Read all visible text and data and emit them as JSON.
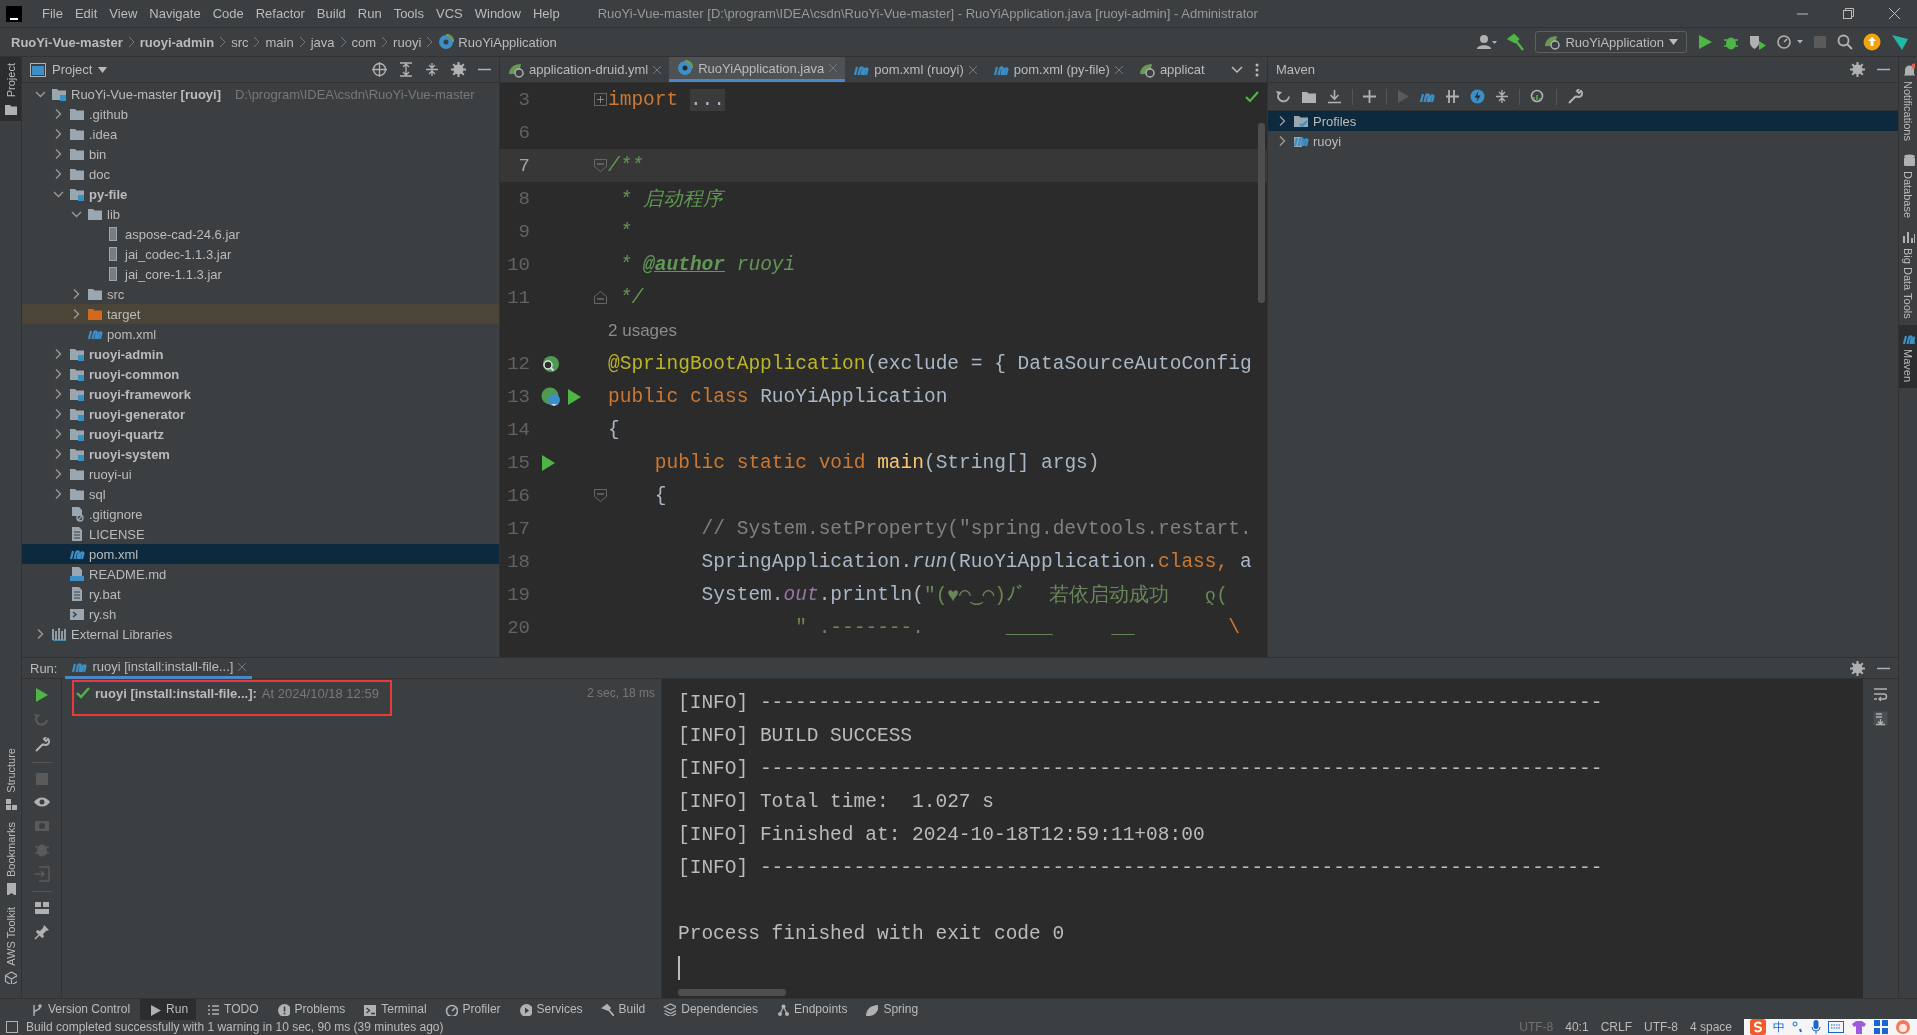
{
  "title_bar": {
    "menu": [
      "File",
      "Edit",
      "View",
      "Navigate",
      "Code",
      "Refactor",
      "Build",
      "Run",
      "Tools",
      "VCS",
      "Window",
      "Help"
    ],
    "title": "RuoYi-Vue-master [D:\\program\\IDEA\\csdn\\RuoYi-Vue-master] - RuoYiApplication.java [ruoyi-admin] - Administrator"
  },
  "nav_bar": {
    "breadcrumbs": [
      {
        "label": "RuoYi-Vue-master",
        "bold": true
      },
      {
        "label": "ruoyi-admin",
        "bold": true
      },
      {
        "label": "src",
        "bold": false
      },
      {
        "label": "main",
        "bold": false
      },
      {
        "label": "java",
        "bold": false
      },
      {
        "label": "com",
        "bold": false
      },
      {
        "label": "ruoyi",
        "bold": false
      },
      {
        "label": "RuoYiApplication",
        "bold": false,
        "kind": "class"
      }
    ],
    "run_config": "RuoYiApplication"
  },
  "left_stripe": [
    {
      "label": "Project",
      "selected": true,
      "kind": "folder"
    },
    {
      "label": "Structure",
      "selected": false,
      "kind": "structure"
    },
    {
      "label": "Bookmarks",
      "selected": false,
      "kind": "bookmark"
    },
    {
      "label": "AWS Toolkit",
      "selected": false,
      "kind": "cube"
    }
  ],
  "right_stripe": [
    {
      "label": "Notifications",
      "selected": false,
      "kind": "bell"
    },
    {
      "label": "Database",
      "selected": false,
      "kind": "database"
    },
    {
      "label": "Big Data Tools",
      "selected": false,
      "kind": "bigdata"
    },
    {
      "label": "Maven",
      "selected": true,
      "kind": "maven"
    }
  ],
  "project_panel": {
    "title": "Project",
    "tree": [
      {
        "label": "RuoYi-Vue-master **[ruoyi]**",
        "path": "D:\\program\\IDEA\\csdn\\RuoYi-Vue-master",
        "kind": "root",
        "expanded": true,
        "selected": false,
        "children": [
          {
            "label": ".github",
            "kind": "folder",
            "expanded": false,
            "selected": false
          },
          {
            "label": ".idea",
            "kind": "folder",
            "expanded": false,
            "selected": false
          },
          {
            "label": "bin",
            "kind": "folder",
            "expanded": false,
            "selected": false
          },
          {
            "label": "doc",
            "kind": "folder",
            "expanded": false,
            "selected": false
          },
          {
            "label": "py-file",
            "kind": "module",
            "expanded": true,
            "selected": false,
            "children": [
              {
                "label": "lib",
                "kind": "folder",
                "expanded": true,
                "selected": false,
                "children": [
                  {
                    "label": "aspose-cad-24.6.jar",
                    "kind": "jar",
                    "selected": false
                  },
                  {
                    "label": "jai_codec-1.1.3.jar",
                    "kind": "jar",
                    "selected": false
                  },
                  {
                    "label": "jai_core-1.1.3.jar",
                    "kind": "jar",
                    "selected": false
                  }
                ]
              },
              {
                "label": "src",
                "kind": "folder",
                "expanded": false,
                "selected": false
              },
              {
                "label": "target",
                "kind": "excluded",
                "expanded": false,
                "selected": false
              },
              {
                "label": "pom.xml",
                "kind": "maven",
                "selected": false
              }
            ]
          },
          {
            "label": "ruoyi-admin",
            "kind": "module",
            "expanded": false,
            "selected": false
          },
          {
            "label": "ruoyi-common",
            "kind": "module",
            "expanded": false,
            "selected": false
          },
          {
            "label": "ruoyi-framework",
            "kind": "module",
            "expanded": false,
            "selected": false
          },
          {
            "label": "ruoyi-generator",
            "kind": "module",
            "expanded": false,
            "selected": false
          },
          {
            "label": "ruoyi-quartz",
            "kind": "module",
            "expanded": false,
            "selected": false
          },
          {
            "label": "ruoyi-system",
            "kind": "module",
            "expanded": false,
            "selected": false
          },
          {
            "label": "ruoyi-ui",
            "kind": "folder",
            "expanded": false,
            "selected": false
          },
          {
            "label": "sql",
            "kind": "folder",
            "expanded": false,
            "selected": false
          },
          {
            "label": ".gitignore",
            "kind": "gitignore",
            "selected": false
          },
          {
            "label": "LICENSE",
            "kind": "text",
            "selected": false
          },
          {
            "label": "pom.xml",
            "kind": "maven",
            "selected": true
          },
          {
            "label": "README.md",
            "kind": "markdown",
            "selected": false
          },
          {
            "label": "ry.bat",
            "kind": "text",
            "selected": false
          },
          {
            "label": "ry.sh",
            "kind": "shell",
            "selected": false
          }
        ]
      },
      {
        "label": "External Libraries",
        "kind": "libraries",
        "expanded": false,
        "selected": false
      }
    ]
  },
  "editor": {
    "tabs": [
      {
        "label": "application-druid.yml",
        "kind": "spring-config",
        "selected": false
      },
      {
        "label": "RuoYiApplication.java",
        "kind": "spring-class",
        "selected": true
      },
      {
        "label": "pom.xml (ruoyi)",
        "kind": "maven",
        "selected": false
      },
      {
        "label": "pom.xml (py-file)",
        "kind": "maven",
        "selected": false
      },
      {
        "label": "applicat",
        "kind": "spring-config",
        "selected": false
      }
    ],
    "lines": [
      {
        "number": "3",
        "fold": {
          "kind": "collapsed"
        },
        "current": false,
        "segments": [
          {
            "text": "import ",
            "kind": "kw"
          },
          {
            "text": "...",
            "kind": "folded"
          }
        ]
      },
      {
        "number": "6",
        "current": false
      },
      {
        "number": "7",
        "fold": {
          "kind": "start"
        },
        "current": true,
        "segments": [
          {
            "text": "/**",
            "kind": "doc"
          }
        ]
      },
      {
        "number": "8",
        "current": false,
        "segments": [
          {
            "text": " * 启动程序",
            "kind": "doc"
          }
        ]
      },
      {
        "number": "9",
        "current": false,
        "segments": [
          {
            "text": " *",
            "kind": "doc"
          }
        ]
      },
      {
        "number": "10",
        "current": false,
        "segments": [
          {
            "text": " * ",
            "kind": "doc"
          },
          {
            "text": "@author",
            "kind": "doctag"
          },
          {
            "text": " ruoyi",
            "kind": "doc"
          }
        ]
      },
      {
        "number": "11",
        "fold": {
          "kind": "end"
        },
        "current": false,
        "segments": [
          {
            "text": " */",
            "kind": "doc"
          }
        ]
      },
      {
        "current": false,
        "segments": [
          {
            "text": "2 usages",
            "kind": "hint"
          }
        ]
      },
      {
        "number": "12",
        "markers": [
          {
            "kind": "bean-search"
          }
        ],
        "current": false,
        "segments": [
          {
            "text": "@SpringBootApplication",
            "kind": "ann"
          },
          {
            "text": "(exclude = { DataSourceAutoConfig",
            "kind": "plain"
          }
        ]
      },
      {
        "number": "13",
        "markers": [
          {
            "kind": "bean"
          },
          {
            "kind": "run"
          }
        ],
        "current": false,
        "segments": [
          {
            "text": "public class ",
            "kind": "kw"
          },
          {
            "text": "RuoYiApplication",
            "kind": "plain"
          }
        ]
      },
      {
        "number": "14",
        "current": false,
        "segments": [
          {
            "text": "{",
            "kind": "plain"
          }
        ]
      },
      {
        "number": "15",
        "markers": [
          {
            "kind": "run"
          }
        ],
        "current": false,
        "segments": [
          {
            "text": "    public static void ",
            "kind": "kw"
          },
          {
            "text": "main",
            "kind": "decl"
          },
          {
            "text": "(String[] args)",
            "kind": "plain"
          }
        ]
      },
      {
        "number": "16",
        "fold": {
          "kind": "start"
        },
        "current": false,
        "segments": [
          {
            "text": "    {",
            "kind": "plain"
          }
        ]
      },
      {
        "number": "17",
        "current": false,
        "segments": [
          {
            "text": "        // System.setProperty(\"spring.devtools.restart.",
            "kind": "comment"
          }
        ]
      },
      {
        "number": "18",
        "current": false,
        "segments": [
          {
            "text": "        SpringApplication.",
            "kind": "plain"
          },
          {
            "text": "run",
            "kind": "call"
          },
          {
            "text": "(RuoYiApplication.",
            "kind": "plain"
          },
          {
            "text": "class, ",
            "kind": "kw"
          },
          {
            "text": "a",
            "kind": "plain"
          }
        ]
      },
      {
        "number": "19",
        "current": false,
        "segments": [
          {
            "text": "        System.",
            "kind": "plain"
          },
          {
            "text": "out",
            "kind": "static"
          },
          {
            "text": ".println(",
            "kind": "plain"
          },
          {
            "text": "\"(♥◠‿◠)ﾉﾞ  若依启动成功   ლ(",
            "kind": "str"
          }
        ]
      },
      {
        "number": "20",
        "current": false,
        "segments": [
          {
            "text": "                \" .-------.       ____     __        ",
            "kind": "str"
          },
          {
            "text": "\\",
            "kind": "esc"
          }
        ]
      }
    ]
  },
  "maven": {
    "title": "Maven",
    "tree": [
      {
        "label": "Profiles",
        "kind": "profiles",
        "selected": true
      },
      {
        "label": "ruoyi",
        "kind": "project",
        "selected": false
      }
    ]
  },
  "run_panel": {
    "label": "Run:",
    "tab": "ruoyi [install:install-file...]",
    "tree_row": {
      "name": "ruoyi [install:install-file...]:",
      "time": "At 2024/10/18 12:59",
      "duration": "2 sec, 18 ms",
      "highlighted": true
    },
    "console": [
      {
        "text": "[INFO] ------------------------------------------------------------------------",
        "kind": "log"
      },
      {
        "text": "[INFO] BUILD SUCCESS",
        "kind": "log"
      },
      {
        "text": "[INFO] ------------------------------------------------------------------------",
        "kind": "log"
      },
      {
        "text": "[INFO] Total time:  1.027 s",
        "kind": "log"
      },
      {
        "text": "[INFO] Finished at: 2024-10-18T12:59:11+08:00",
        "kind": "log"
      },
      {
        "text": "[INFO] ------------------------------------------------------------------------",
        "kind": "log"
      },
      {
        "text": "Process finished with exit code 0",
        "kind": "exit"
      }
    ]
  },
  "tool_tabs": [
    {
      "label": "Version Control",
      "kind": "vcs",
      "selected": false
    },
    {
      "label": "Run",
      "kind": "run",
      "selected": true
    },
    {
      "label": "TODO",
      "kind": "todo",
      "selected": false
    },
    {
      "label": "Problems",
      "kind": "problems",
      "selected": false
    },
    {
      "label": "Terminal",
      "kind": "terminal",
      "selected": false
    },
    {
      "label": "Profiler",
      "kind": "profiler",
      "selected": false
    },
    {
      "label": "Services",
      "kind": "services",
      "selected": false
    },
    {
      "label": "Build",
      "kind": "build",
      "selected": false
    },
    {
      "label": "Dependencies",
      "kind": "dependencies",
      "selected": false
    },
    {
      "label": "Endpoints",
      "kind": "endpoints",
      "selected": false
    },
    {
      "label": "Spring",
      "kind": "spring",
      "selected": false
    }
  ],
  "status_bar": {
    "message": "Build completed successfully with 1 warning in 10 sec, 90 ms (39 minutes ago)",
    "items": [
      {
        "label": "UTF-8",
        "disabled": true
      },
      {
        "label": "40:1",
        "disabled": false
      },
      {
        "label": "CRLF",
        "disabled": false
      },
      {
        "label": "UTF-8",
        "disabled": false
      },
      {
        "label": "4 space",
        "disabled": false
      }
    ],
    "ime_mode": "中"
  }
}
